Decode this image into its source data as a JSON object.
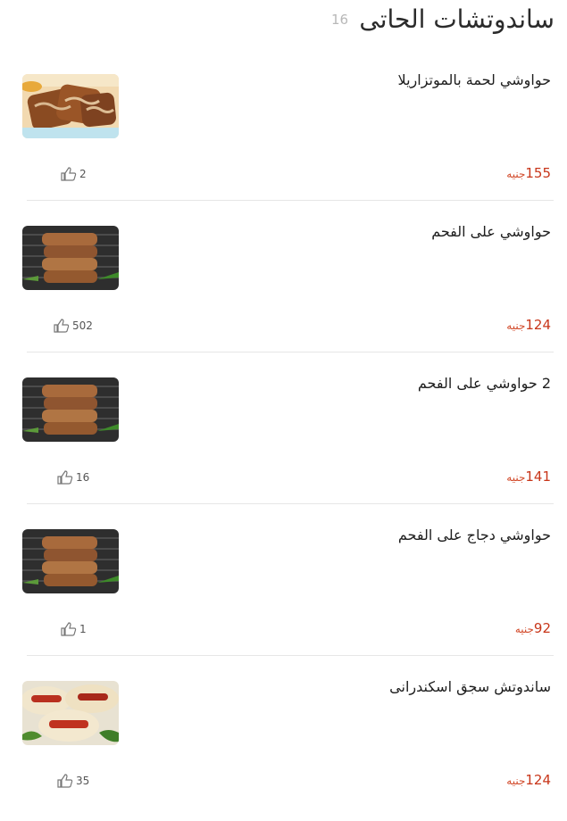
{
  "header": {
    "title": "ساندوتشات الحاتى",
    "count": "16"
  },
  "currency_label": "جنيه",
  "items": [
    {
      "name": "حواوشي لحمة بالموتزاريلا",
      "price": "155",
      "likes": "2",
      "image": "hawawshi-mozzarella-photo"
    },
    {
      "name": "حواوشي على الفحم",
      "price": "124",
      "likes": "502",
      "image": "hawawshi-charcoal-photo"
    },
    {
      "name": "2 حواوشي على الفحم",
      "price": "141",
      "likes": "16",
      "image": "hawawshi-charcoal-photo"
    },
    {
      "name": "حواوشي دجاج على الفحم",
      "price": "92",
      "likes": "1",
      "image": "hawawshi-charcoal-photo"
    },
    {
      "name": "ساندوتش سجق اسكندرانى",
      "price": "124",
      "likes": "35",
      "image": "alexandrian-sausage-photo"
    }
  ],
  "icons": {
    "like": "thumbs-up-icon"
  }
}
